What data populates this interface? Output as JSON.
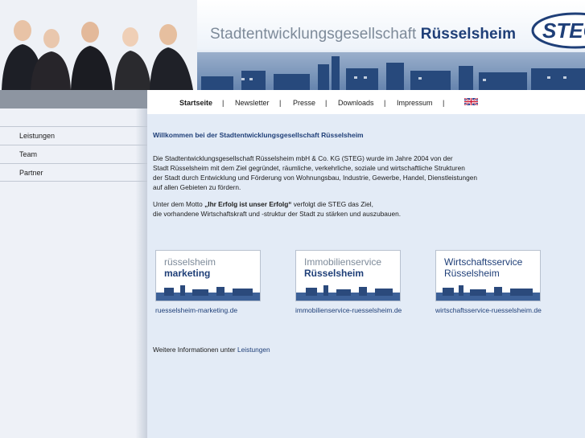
{
  "header": {
    "title_regular": "Stadtentwicklungsgesellschaft",
    "title_bold": "Rüsselsheim",
    "logo_text": "STEG"
  },
  "nav": {
    "items": [
      "Startseite",
      "Newsletter",
      "Presse",
      "Downloads",
      "Impressum"
    ],
    "separator": "|",
    "language_flag": "uk-flag-icon"
  },
  "sidebar": {
    "items": [
      "Leistungen",
      "Team",
      "Partner"
    ]
  },
  "main": {
    "welcome": "Willkommen bei der Stadtentwicklungsgesellschaft Rüsselsheim",
    "intro_lines": [
      "Die Stadtentwicklungsgesellschaft Rüsselsheim mbH & Co. KG (STEG) wurde im Jahre 2004 von der",
      "Stadt Rüsselsheim mit dem Ziel gegründet, räumliche, verkehrliche, soziale und wirtschaftliche Strukturen",
      "der Stadt durch Entwicklung und Förderung von Wohnungsbau, Industrie, Gewerbe, Handel, Dienstleistungen",
      "auf allen Gebieten zu fördern."
    ],
    "motto_prefix": "Unter dem Motto ",
    "motto": "„Ihr Erfolg ist unser Erfolg“",
    "motto_suffix": " verfolgt die STEG das Ziel,",
    "motto_line2": "die vorhandene Wirtschaftskraft und -struktur der Stadt zu stärken und auszubauen.",
    "more_prefix": "Weitere Informationen unter ",
    "more_link": "Leistungen"
  },
  "partners": [
    {
      "line1": "rüsselsheim",
      "line2": "marketing",
      "link": "ruesselsheim-marketing.de"
    },
    {
      "line1": "Immobilienservice",
      "line2": "Rüsselsheim",
      "link": "immobilienservice-ruesselsheim.de"
    },
    {
      "line1": "Wirtschaftsservice",
      "line2": "Rüsselsheim",
      "link": "wirtschaftsservice-ruesselsheim.de"
    }
  ],
  "colors": {
    "brand_blue": "#1f3f78",
    "title_gray": "#7d8a99",
    "content_bg": "#e3ebf6",
    "sidebar_bg": "#eef1f7",
    "sidebar_top": "#8d95a1"
  }
}
